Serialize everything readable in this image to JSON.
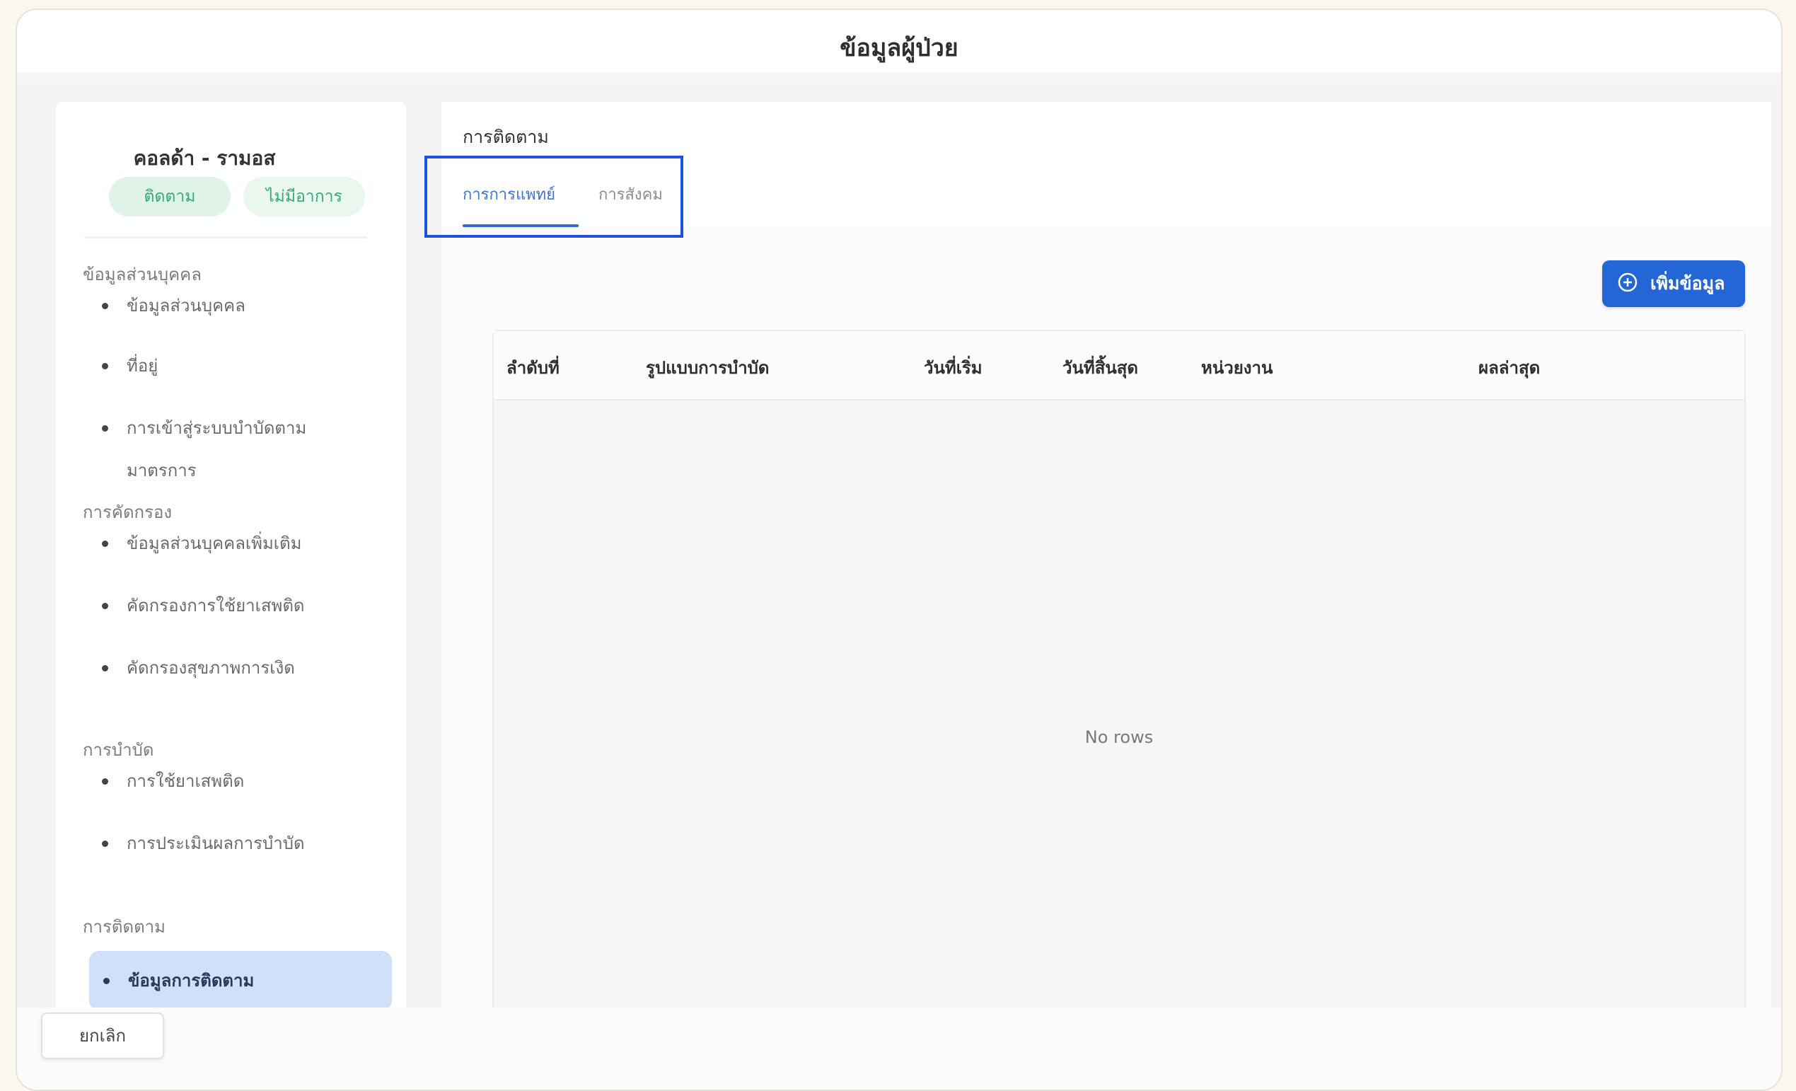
{
  "window": {
    "title": "ข้อมูลผู้ป่วย"
  },
  "patient": {
    "name": "คอลด้า - รามอส",
    "status_follow": "ติดตาม",
    "status_other": "ไม่มีอาการ"
  },
  "sidebar": {
    "sections": [
      {
        "title": "ข้อมูลส่วนบุคคล",
        "items": [
          "ข้อมูลส่วนบุคคล",
          "ที่อยู่",
          "การเข้าสู่ระบบบำบัดตามมาตรการ"
        ]
      },
      {
        "title": "การคัดกรอง",
        "items": [
          "ข้อมูลส่วนบุคคลเพิ่มเติม",
          "คัดกรองการใช้ยาเสพติด",
          "คัดกรองสุขภาพการเงิด"
        ]
      },
      {
        "title": "การบำบัด",
        "items": [
          "การใช้ยาเสพติด",
          "การประเมินผลการบำบัด"
        ]
      },
      {
        "title": "การติดตาม",
        "items": [
          "ข้อมูลการติดตาม"
        ]
      }
    ],
    "active_item": "ข้อมูลการติดตาม"
  },
  "main": {
    "section_label": "การติดตาม",
    "tabs": [
      {
        "label": "การการแพทย์",
        "active": true
      },
      {
        "label": "การสังคม",
        "active": false
      }
    ],
    "add_button_label": "เพิ่มข้อมูล",
    "table": {
      "columns": [
        "ลำดับที่",
        "รูปแบบการบำบัด",
        "วันที่เริ่ม",
        "วันที่สิ้นสุด",
        "หน่วยงาน",
        "ผลล่าสุด"
      ],
      "rows": [],
      "empty_text": "No rows"
    }
  },
  "footer": {
    "cancel_label": "ยกเลิก"
  },
  "colors": {
    "primary": "#2466d6",
    "accent_green": "#3aa776",
    "active_item_bg": "#cfe0f8",
    "highlight": "#1b52e0"
  }
}
